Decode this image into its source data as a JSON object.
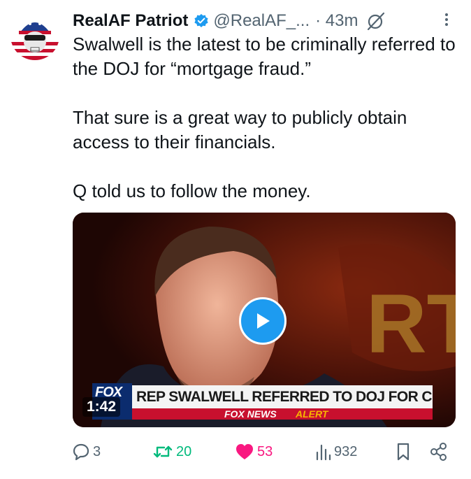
{
  "tweet": {
    "author_name": "RealAF Patriot",
    "handle": "@RealAF_...",
    "time": "· 43m",
    "verified": true,
    "paragraphs": [
      "Swalwell is the latest to be criminally referred to the DOJ for “mortgage fraud.”",
      "That sure is a great way to publicly obtain access to their financials.",
      "Q told us to follow the money."
    ]
  },
  "media": {
    "duration": "1:42",
    "chyron_headline": "REP SWALWELL REFERRED TO DOJ FOR CRIMINAL PROBE",
    "alert_brand": "FOX NEWS",
    "alert_word": "ALERT",
    "logo_text": "FOX"
  },
  "actions": {
    "replies": "3",
    "reposts": "20",
    "likes": "53",
    "views": "932"
  },
  "colors": {
    "text": "#0f1419",
    "secondary": "#536471",
    "verified": "#1d9bf0",
    "repost": "#00ba7c",
    "like": "#f91880",
    "play": "#1d9bf0"
  },
  "icons": [
    "avatar-skull-flag",
    "verified-badge-icon",
    "grok-icon",
    "more-icon",
    "play-icon",
    "reply-icon",
    "repost-icon",
    "like-icon",
    "views-icon",
    "bookmark-icon",
    "share-icon"
  ]
}
